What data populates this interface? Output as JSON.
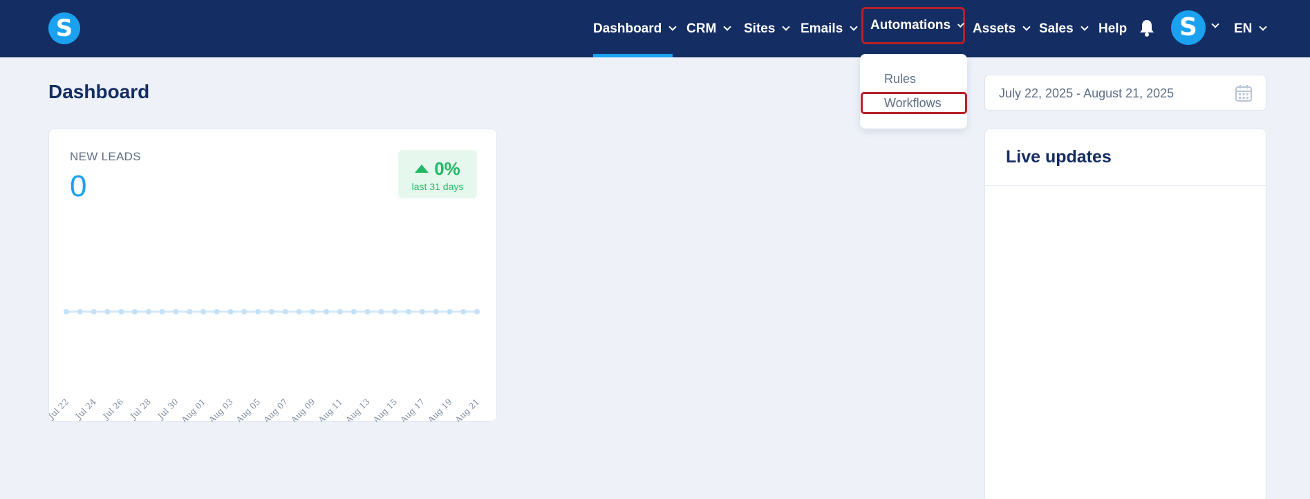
{
  "app": {
    "logo_letter": "S",
    "avatar_letter": "S"
  },
  "nav": {
    "dashboard": "Dashboard",
    "crm": "CRM",
    "sites": "Sites",
    "emails": "Emails",
    "automations": "Automations",
    "assets": "Assets",
    "sales": "Sales",
    "help": "Help",
    "language": "EN",
    "active": "Dashboard"
  },
  "automations_menu": {
    "rules": "Rules",
    "workflows": "Workflows"
  },
  "page": {
    "title": "Dashboard"
  },
  "date_range": {
    "value": "July 22, 2025 - August 21, 2025"
  },
  "leads": {
    "label": "NEW LEADS",
    "value": "0",
    "change": "0%",
    "change_period": "last 31 days"
  },
  "live_updates": {
    "title": "Live updates"
  },
  "colors": {
    "nav_bg": "#142d63",
    "accent": "#1aa1f0",
    "positive": "#22b865",
    "highlight": "#b8202a"
  },
  "chart_data": {
    "type": "line",
    "x": [
      "Jul 22",
      "Jul 23",
      "Jul 24",
      "Jul 25",
      "Jul 26",
      "Jul 27",
      "Jul 28",
      "Jul 29",
      "Jul 30",
      "Jul 31",
      "Aug 01",
      "Aug 02",
      "Aug 03",
      "Aug 04",
      "Aug 05",
      "Aug 06",
      "Aug 07",
      "Aug 08",
      "Aug 09",
      "Aug 10",
      "Aug 11",
      "Aug 12",
      "Aug 13",
      "Aug 14",
      "Aug 15",
      "Aug 16",
      "Aug 17",
      "Aug 18",
      "Aug 19",
      "Aug 20",
      "Aug 21"
    ],
    "tick_labels": [
      "Jul 22",
      "Jul 24",
      "Jul 26",
      "Jul 28",
      "Jul 30",
      "Aug 01",
      "Aug 03",
      "Aug 05",
      "Aug 07",
      "Aug 09",
      "Aug 11",
      "Aug 13",
      "Aug 15",
      "Aug 17",
      "Aug 19",
      "Aug 21"
    ],
    "series": [
      {
        "values": [
          0,
          0,
          0,
          0,
          0,
          0,
          0,
          0,
          0,
          0,
          0,
          0,
          0,
          0,
          0,
          0,
          0,
          0,
          0,
          0,
          0,
          0,
          0,
          0,
          0,
          0,
          0,
          0,
          0,
          0,
          0
        ]
      }
    ],
    "grid": false
  }
}
